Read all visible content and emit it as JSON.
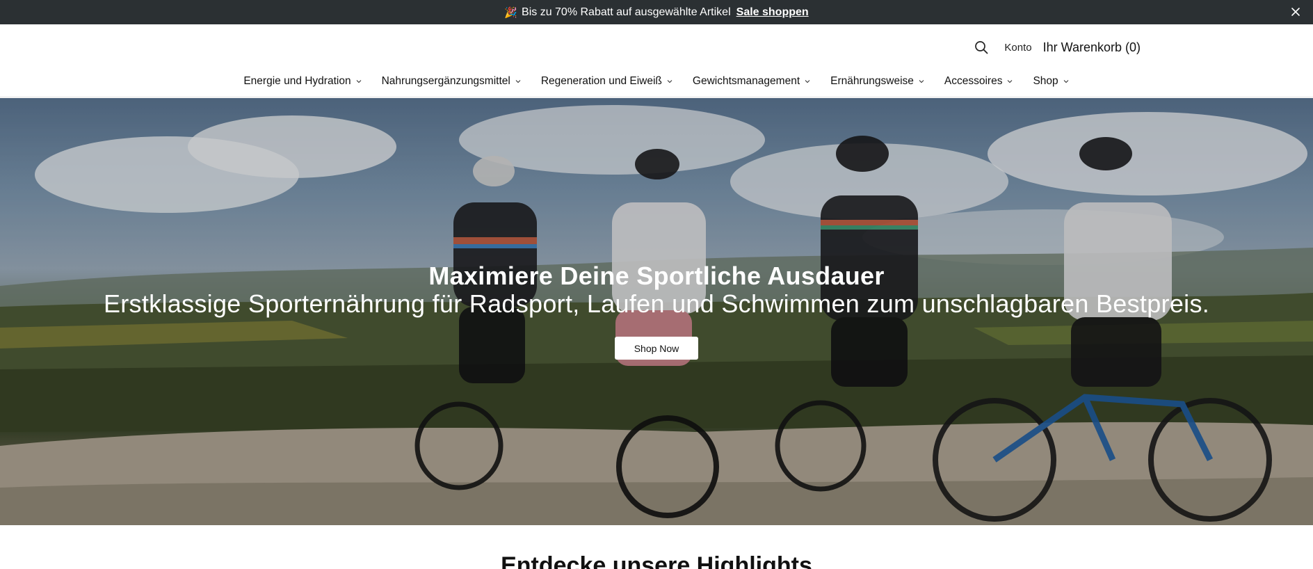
{
  "announcement": {
    "emoji": "🎉",
    "text": "Bis zu 70% Rabatt auf ausgewählte Artikel",
    "link": "Sale shoppen",
    "close_icon": "close-icon"
  },
  "header": {
    "search_icon": "search-icon",
    "account": "Konto",
    "cart": "Ihr Warenkorb (0)"
  },
  "nav": {
    "items": [
      {
        "label": "Energie und Hydration"
      },
      {
        "label": "Nahrungsergänzungsmittel"
      },
      {
        "label": "Regeneration und Eiweiß"
      },
      {
        "label": "Gewichtsmanagement"
      },
      {
        "label": "Ernährungsweise"
      },
      {
        "label": "Accessoires"
      },
      {
        "label": "Shop"
      }
    ],
    "chevron_icon": "chevron-down-icon"
  },
  "hero": {
    "heading": "Maximiere Deine Sportliche Ausdauer",
    "subheading": "Erstklassige Sporternährung für Radsport, Laufen und Schwimmen zum unschlagbaren Bestpreis.",
    "button": "Shop Now"
  },
  "highlights": {
    "title": "Entdecke unsere Highlights"
  },
  "colors": {
    "announcement_bg": "#2b3033",
    "button_bg": "#ffffff",
    "text": "#111111"
  }
}
